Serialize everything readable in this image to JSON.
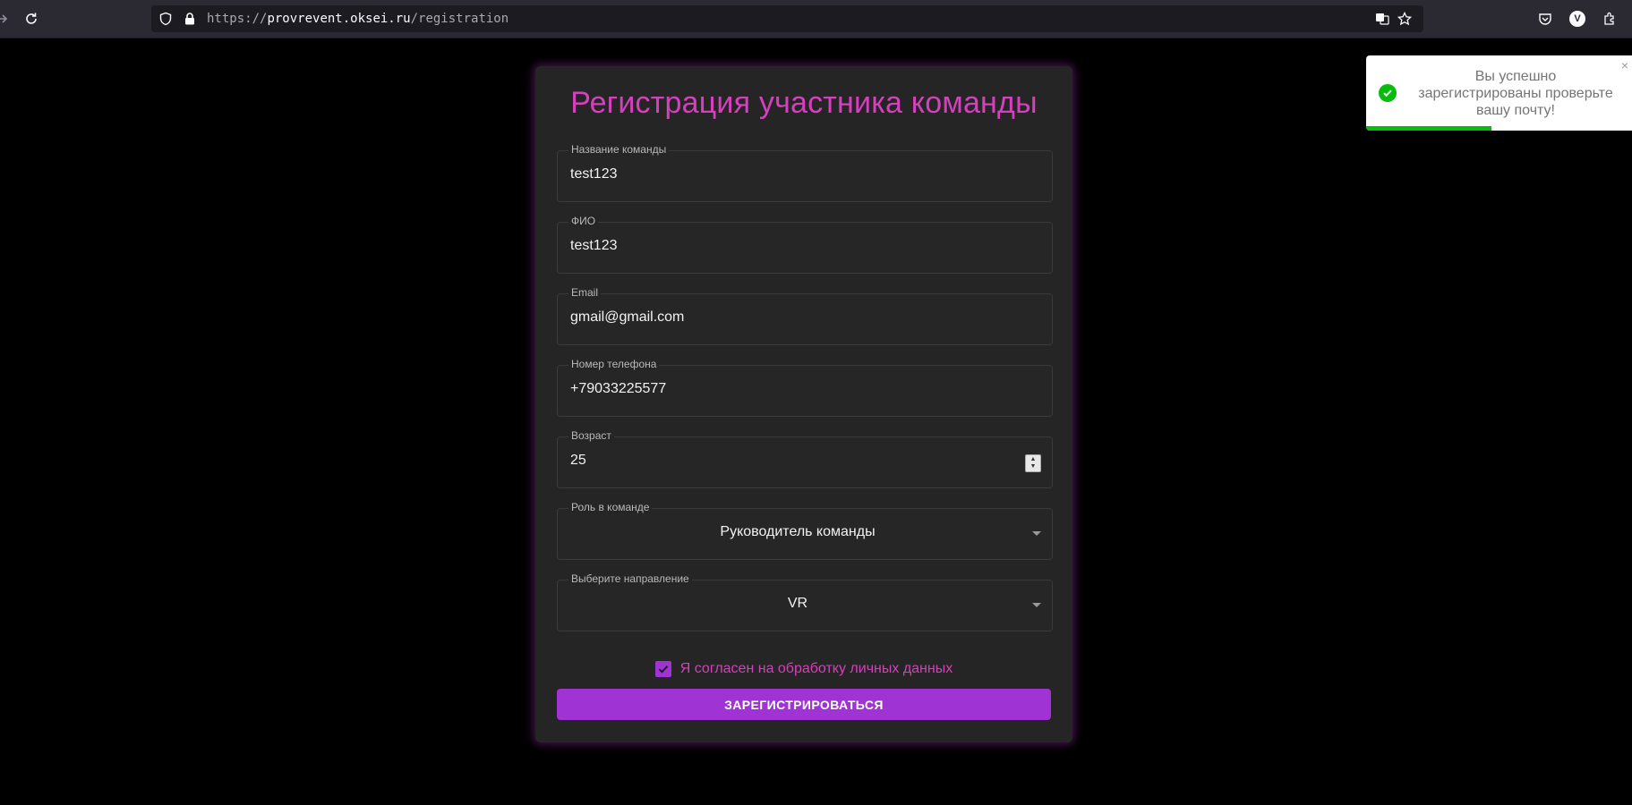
{
  "browser": {
    "url_host": "provrevent.oksei.ru",
    "url_scheme": "https://",
    "url_path": "/registration"
  },
  "form": {
    "title": "Регистрация участника команды",
    "fields": [
      {
        "label": "Название команды",
        "value": "test123"
      },
      {
        "label": "ФИО",
        "value": "test123"
      },
      {
        "label": "Email",
        "value": "gmail@gmail.com"
      },
      {
        "label": "Номер телефона",
        "value": "+79033225577"
      },
      {
        "label": "Возраст",
        "value": "25"
      },
      {
        "label": "Роль в команде",
        "value": "Руководитель команды"
      },
      {
        "label": "Выберите направление",
        "value": "VR"
      }
    ],
    "consent_label": "Я согласен на обработку личных данных",
    "consent_checked": true,
    "submit_label": "ЗАРЕГИСТРИРОВАТЬСЯ",
    "accent_color": "#a033d4",
    "title_color": "#d63fbd"
  },
  "toast": {
    "message": "Вы успешно зарегистрированы проверьте вашу почту!",
    "close_glyph": "×",
    "progress": 0.47,
    "status_color": "#07bc0c"
  }
}
